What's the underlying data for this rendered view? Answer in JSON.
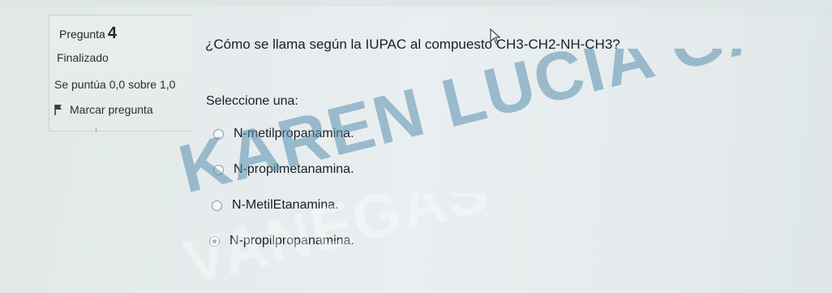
{
  "question_info": {
    "label": "Pregunta",
    "number": "4",
    "state": "Finalizado",
    "grade": "Se puntúa 0,0 sobre 1,0",
    "flag_label": "Marcar pregunta"
  },
  "question": {
    "text": "¿Cómo se llama según la IUPAC al compuesto CH3-CH2-NH-CH3?",
    "prompt": "Seleccione una:",
    "options": [
      {
        "label": "N-metilpropanamina.",
        "selected": false
      },
      {
        "label": "N-propilmetanamina.",
        "selected": false
      },
      {
        "label": "N-MetilEtanamina.",
        "selected": false
      },
      {
        "label": "N-propilpropanamina.",
        "selected": true
      }
    ]
  },
  "watermark": {
    "line1": "KAREN LUCIA GALVIS",
    "line2": "VANEGAS",
    "color": "#5a90b0"
  },
  "icons": {
    "flag": "flag-icon",
    "cursor": "pointer-cursor-icon"
  }
}
